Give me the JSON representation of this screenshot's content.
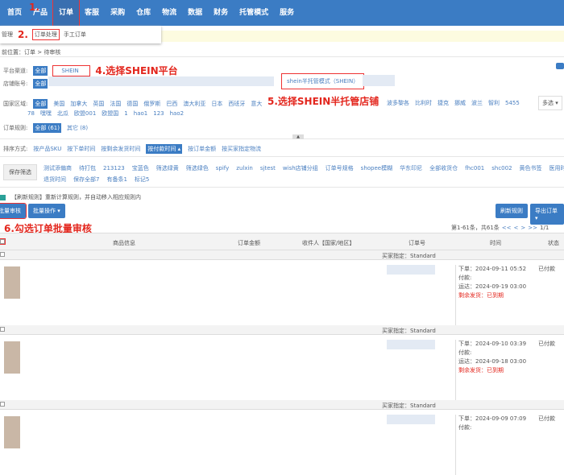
{
  "nav": [
    "首页",
    "产品",
    "订单",
    "客服",
    "采购",
    "仓库",
    "物流",
    "数据",
    "财务",
    "托管模式",
    "服务"
  ],
  "subnav": {
    "prefix": "管理",
    "items": [
      "订单处理",
      "手工订单"
    ]
  },
  "annotations": {
    "a1": "1.",
    "a2": "2.",
    "a4": "4.选择SHEIN平台",
    "a5": "5.选择SHEIN半托管店铺",
    "a6": "6.勾选订单批量审核"
  },
  "breadcrumb": "前位置：订单 > 待审核",
  "platform": {
    "label": "平台渠道:",
    "all": "全部",
    "selected": "SHEIN"
  },
  "shop": {
    "label": "店铺账号:",
    "all": "全部",
    "selected": "shein半托管模式（SHEIN）"
  },
  "country": {
    "label": "国家区域:",
    "items": [
      "全部",
      "美国",
      "加拿大",
      "英国",
      "法国",
      "德国",
      "俄罗斯",
      "巴西",
      "澳大利亚",
      "日本",
      "西班牙",
      "意大"
    ],
    "items_right": [
      "波多黎各",
      "比利时",
      "捷克",
      "挪威",
      "波兰",
      "智利",
      "5455"
    ],
    "row2": [
      "78",
      "嘿嘿",
      "北瓜",
      "欧盟001",
      "欧盟国",
      "1",
      "hao1",
      "123",
      "hao2"
    ],
    "multi": "多选 ▾"
  },
  "rules": {
    "label": "订单规则:",
    "all": "全部 (61)",
    "other": "其它 (8)"
  },
  "sort": {
    "label": "排序方式:",
    "items": [
      "按产品SKU",
      "按下单时间",
      "按剩余发货时间",
      "按付款时间 ▴",
      "按订单金额",
      "按买家指定物流"
    ]
  },
  "filters": {
    "save": "保存筛选",
    "row1": [
      "测试添偏商",
      "待打包",
      "213123",
      "宝蓝色",
      "筛选绿黄",
      "筛选绿色",
      "spify",
      "zulxin",
      "sjtest",
      "wish店铺分组",
      "订单号规格",
      "shopee模糊",
      "华东印尼",
      "全部收货仓",
      "fhc001",
      "shc002",
      "黄色书签",
      "医用时间"
    ],
    "row2": [
      "退货时间",
      "保存全部7",
      "有备条1",
      "标记5"
    ]
  },
  "notice": "【刷新规则】重新计算规则，并自动移入相应规则内",
  "actions": {
    "batch_review": "批量审核",
    "batch_ops": "批量操作 ▾",
    "refresh": "刷新规则",
    "export": "导出订单 ▾"
  },
  "pager": {
    "summary": "第1-61条，共61条",
    "buttons": [
      "<<",
      "<",
      ">",
      ">>"
    ],
    "page": "1/1"
  },
  "columns": [
    "商品信息",
    "订单金额",
    "收件人【国家/地区】",
    "订单号",
    "时间",
    "状态"
  ],
  "orders": [
    {
      "buyer": "买家指定：Standard",
      "placed": "下单：2024-09-11 05:52",
      "paid": "付款:",
      "ship": "运达：2024-09-19 03:00",
      "remain": "剩余发货：已到期",
      "status": "已付款"
    },
    {
      "buyer": "买家指定：Standard",
      "placed": "下单：2024-09-10 03:39",
      "paid": "付款:",
      "ship": "运达：2024-09-18 03:00",
      "remain": "剩余发货：已到期",
      "status": "已付款"
    },
    {
      "buyer": "买家指定：Standard",
      "placed": "下单：2024-09-09 07:09",
      "paid": "付款:",
      "ship": "",
      "remain": "",
      "status": "已付款"
    }
  ]
}
